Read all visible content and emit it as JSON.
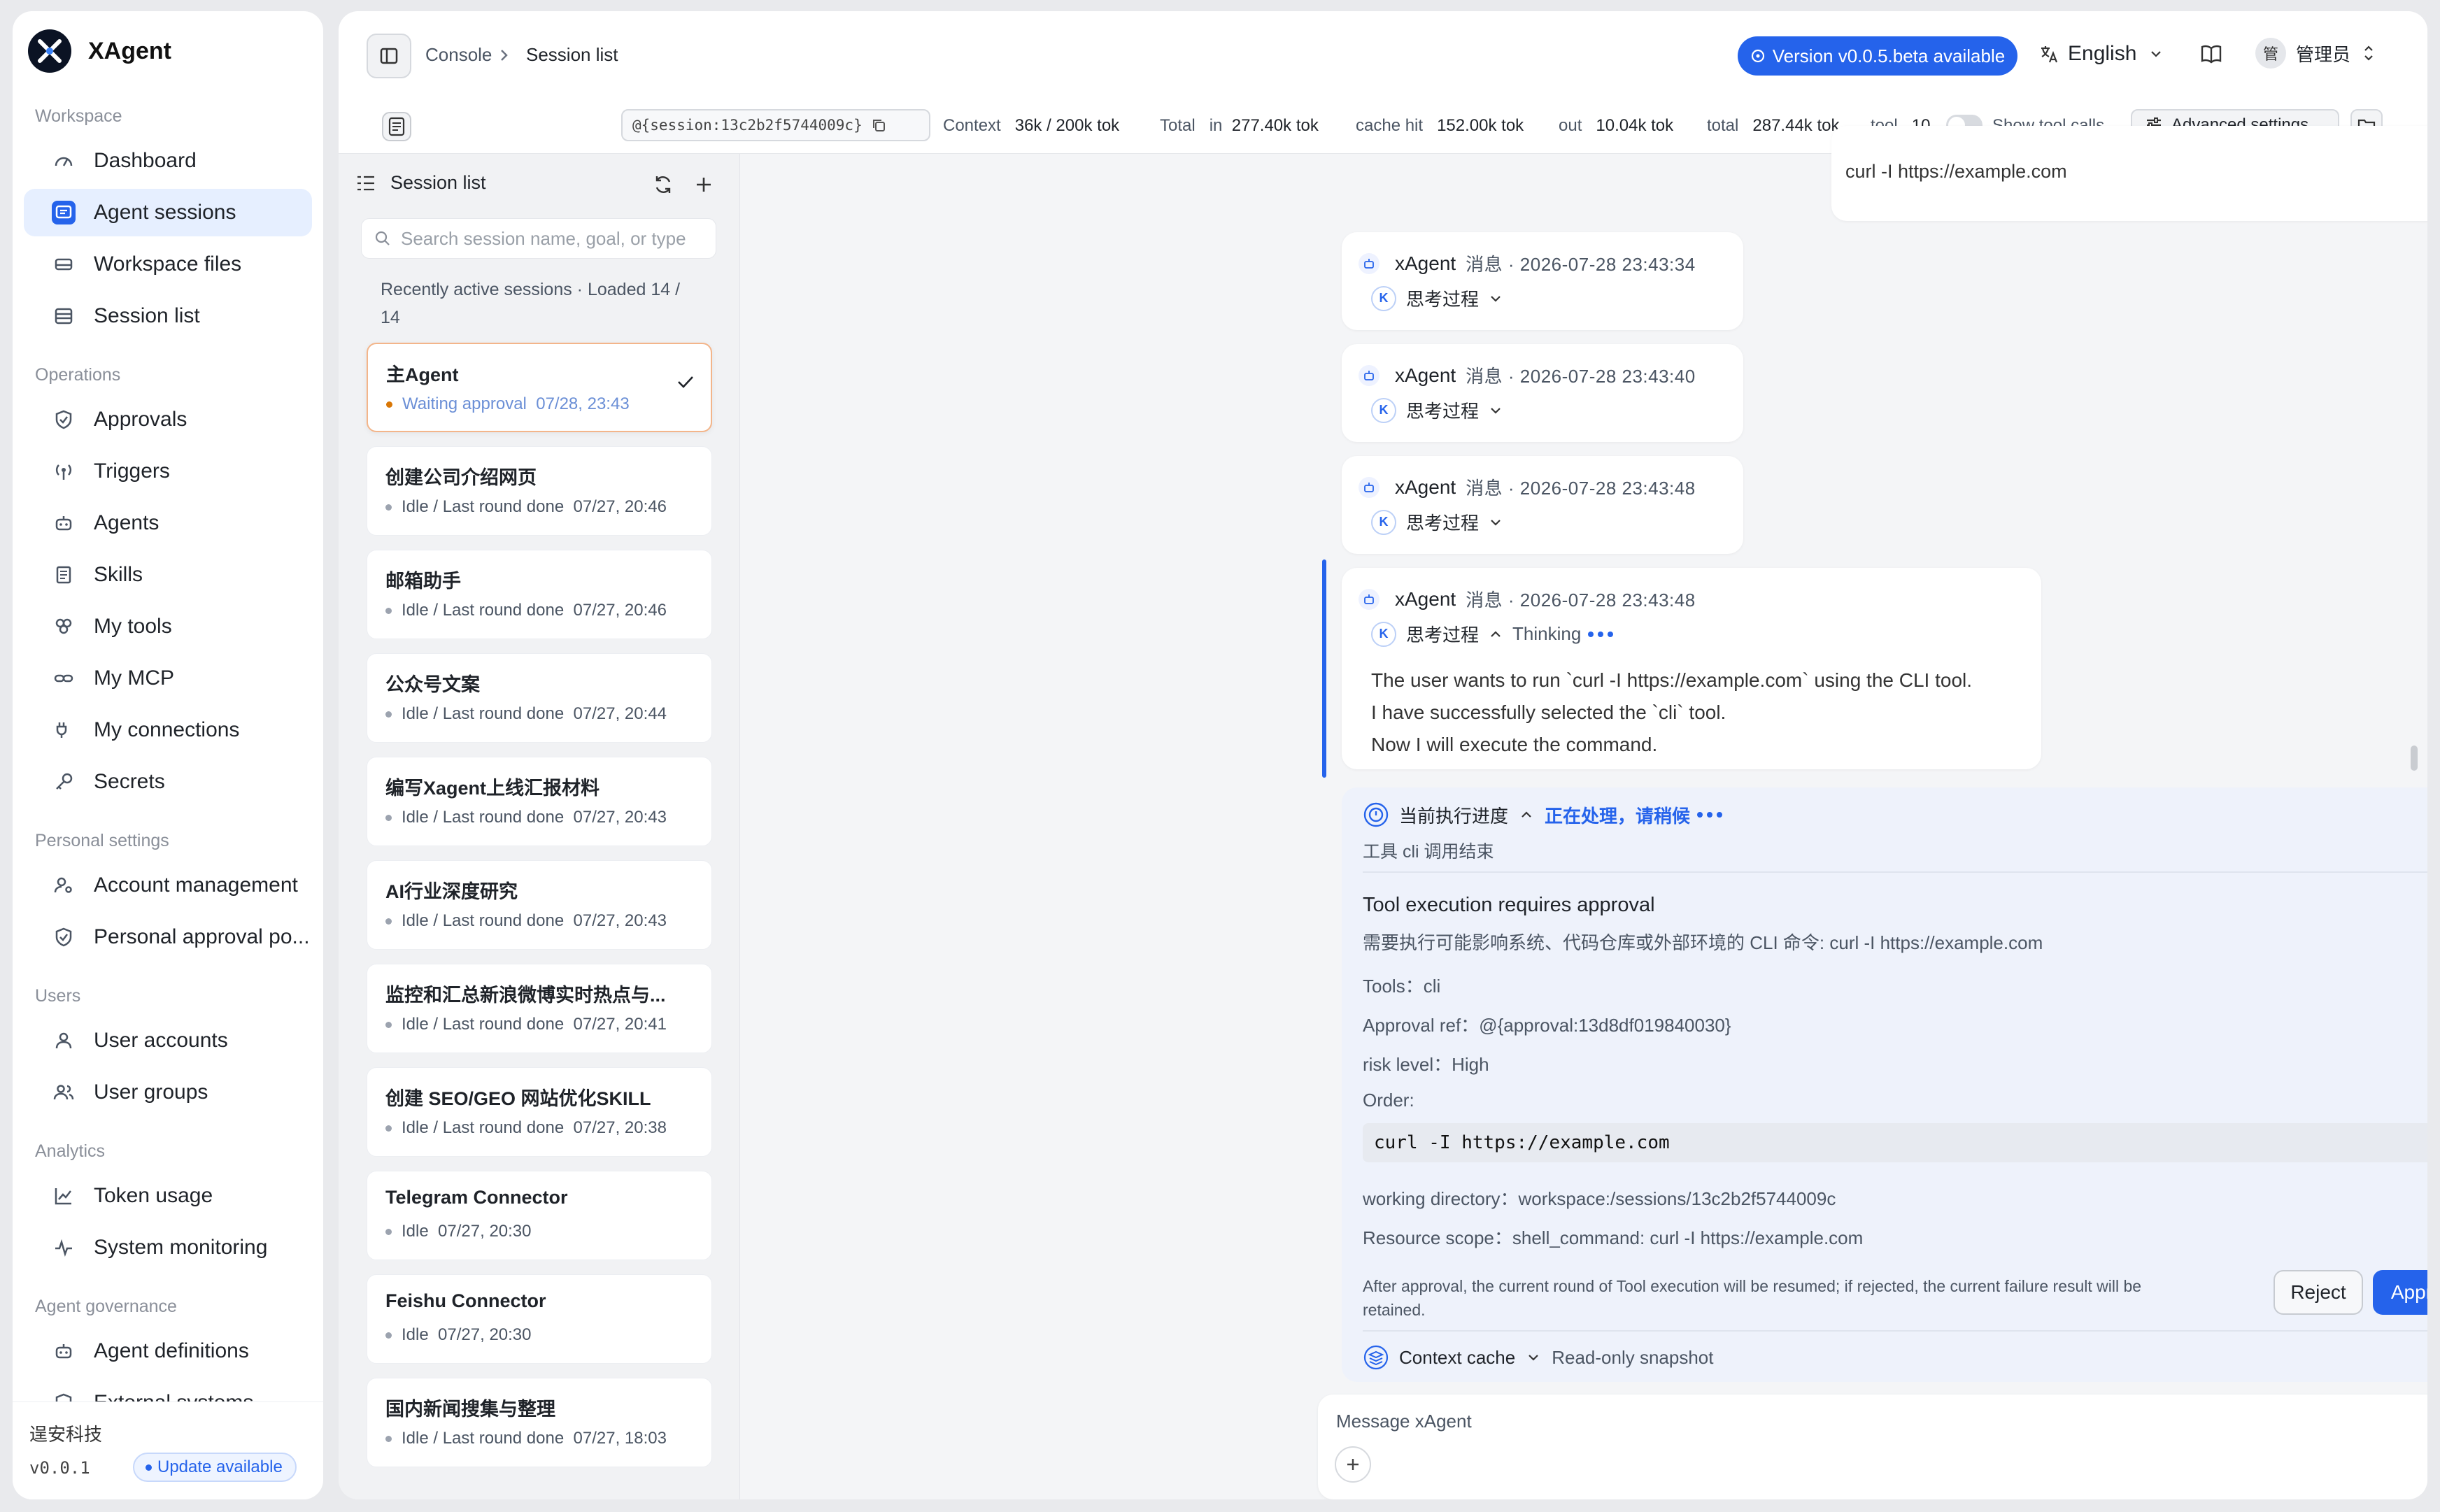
{
  "sidebar": {
    "brand": "XAgent",
    "sections": [
      {
        "title": "Workspace",
        "items": [
          {
            "label": "Dashboard",
            "icon": "gauge-icon"
          },
          {
            "label": "Agent sessions",
            "icon": "chat-icon",
            "active": true
          },
          {
            "label": "Workspace files",
            "icon": "drive-icon"
          },
          {
            "label": "Session list",
            "icon": "list-icon"
          }
        ]
      },
      {
        "title": "Operations",
        "items": [
          {
            "label": "Approvals",
            "icon": "shield-check-icon"
          },
          {
            "label": "Triggers",
            "icon": "broadcast-icon"
          },
          {
            "label": "Agents",
            "icon": "robot-icon"
          },
          {
            "label": "Skills",
            "icon": "book-icon"
          },
          {
            "label": "My tools",
            "icon": "tools-icon"
          },
          {
            "label": "My MCP",
            "icon": "link-icon"
          },
          {
            "label": "My connections",
            "icon": "plug-icon"
          },
          {
            "label": "Secrets",
            "icon": "key-icon"
          }
        ]
      },
      {
        "title": "Personal settings",
        "items": [
          {
            "label": "Account management",
            "icon": "user-gear-icon"
          },
          {
            "label": "Personal approval po...",
            "icon": "shield-icon"
          }
        ]
      },
      {
        "title": "Users",
        "items": [
          {
            "label": "User accounts",
            "icon": "user-icon"
          },
          {
            "label": "User groups",
            "icon": "users-icon"
          }
        ]
      },
      {
        "title": "Analytics",
        "items": [
          {
            "label": "Token usage",
            "icon": "chart-line-icon"
          },
          {
            "label": "System monitoring",
            "icon": "pulse-icon"
          }
        ]
      },
      {
        "title": "Agent governance",
        "items": [
          {
            "label": "Agent definitions",
            "icon": "robot-icon"
          },
          {
            "label": "External systems",
            "icon": "shield-icon"
          }
        ]
      }
    ],
    "footer": {
      "org": "逞安科技",
      "version": "v0.0.1",
      "update": "Update available"
    }
  },
  "topbar": {
    "breadcrumb_root": "Console",
    "breadcrumb_current": "Session list",
    "version_button": "Version v0.0.5.beta available",
    "language": "English",
    "user_avatar": "管",
    "user_name": "管理员"
  },
  "statusbar": {
    "session_ref": "@{session:13c2b2f5744009c}",
    "context_label": "Context",
    "context_value": "36k / 200k tok",
    "total_label": "Total",
    "in_label": "in",
    "in_value": "277.40k tok",
    "cache_label": "cache hit",
    "cache_value": "152.00k tok",
    "out_label": "out",
    "out_value": "10.04k tok",
    "total2_label": "total",
    "total2_value": "287.44k tok",
    "tool_label": "tool",
    "tool_value": "10",
    "show_tool_calls": "Show tool calls",
    "advanced": "Advanced settings"
  },
  "session_list": {
    "title": "Session list",
    "search_placeholder": "Search session name, goal, or type",
    "note": "Recently active sessions · Loaded 14 / 14",
    "items": [
      {
        "title": "主Agent",
        "status": "Waiting approval",
        "time": "07/28, 23:43",
        "active": true
      },
      {
        "title": "创建公司介绍网页",
        "status": "Idle / Last round done",
        "time": "07/27, 20:46"
      },
      {
        "title": "邮箱助手",
        "status": "Idle / Last round done",
        "time": "07/27, 20:46"
      },
      {
        "title": "公众号文案",
        "status": "Idle / Last round done",
        "time": "07/27, 20:44"
      },
      {
        "title": "编写Xagent上线汇报材料",
        "status": "Idle / Last round done",
        "time": "07/27, 20:43"
      },
      {
        "title": "AI行业深度研究",
        "status": "Idle / Last round done",
        "time": "07/27, 20:43"
      },
      {
        "title": "监控和汇总新浪微博实时热点与...",
        "status": "Idle / Last round done",
        "time": "07/27, 20:41"
      },
      {
        "title": "创建 SEO/GEO 网站优化SKILL",
        "status": "Idle / Last round done",
        "time": "07/27, 20:38"
      },
      {
        "title": "Telegram Connector",
        "status": "Idle",
        "time": "07/27, 20:30"
      },
      {
        "title": "Feishu Connector",
        "status": "Idle",
        "time": "07/27, 20:30"
      },
      {
        "title": "国内新闻搜集与整理",
        "status": "Idle / Last round done",
        "time": "07/27, 18:03"
      }
    ]
  },
  "chat": {
    "top_snippet": "curl -I https://example.com",
    "messages": [
      {
        "name": "xAgent",
        "meta": "消息 · 2026-07-28 23:43:34",
        "think": "思考过程"
      },
      {
        "name": "xAgent",
        "meta": "消息 · 2026-07-28 23:43:40",
        "think": "思考过程"
      },
      {
        "name": "xAgent",
        "meta": "消息 · 2026-07-28 23:43:48",
        "think": "思考过程"
      },
      {
        "name": "xAgent",
        "meta": "消息 · 2026-07-28 23:43:48",
        "think": "思考过程",
        "thinking_label": "Thinking",
        "lines": [
          "The user wants to run `curl -I https://example.com` using the CLI tool.",
          "I have successfully selected the `cli` tool.",
          "Now I will execute the command."
        ]
      }
    ],
    "approval": {
      "progress_label": "当前执行进度",
      "progress_status": "正在处理，请稍候",
      "tool_done": "工具 cli 调用结束",
      "title": "Tool execution requires approval",
      "desc": "需要执行可能影响系统、代码仓库或外部环境的 CLI 命令: curl -I https://example.com",
      "tools": "Tools：cli",
      "approval_ref": "Approval ref：@{approval:13d8df019840030}",
      "risk": "risk level：High",
      "order_label": "Order:",
      "command": "curl -I https://example.com",
      "workdir": "working directory：workspace:/sessions/13c2b2f5744009c",
      "scope": "Resource scope：shell_command: curl -I https://example.com",
      "note_line1": "After approval, the current round of Tool execution will be resumed; if rejected, the current failure result will be",
      "note_line2": "retained.",
      "reject": "Reject",
      "approve": "Approve",
      "context_cache": "Context cache",
      "readonly": "Read-only snapshot"
    },
    "composer_placeholder": "Message xAgent"
  },
  "colors": {
    "accent": "#2563eb",
    "warning_dot": "#d97706",
    "active_border": "#f3b58a"
  }
}
